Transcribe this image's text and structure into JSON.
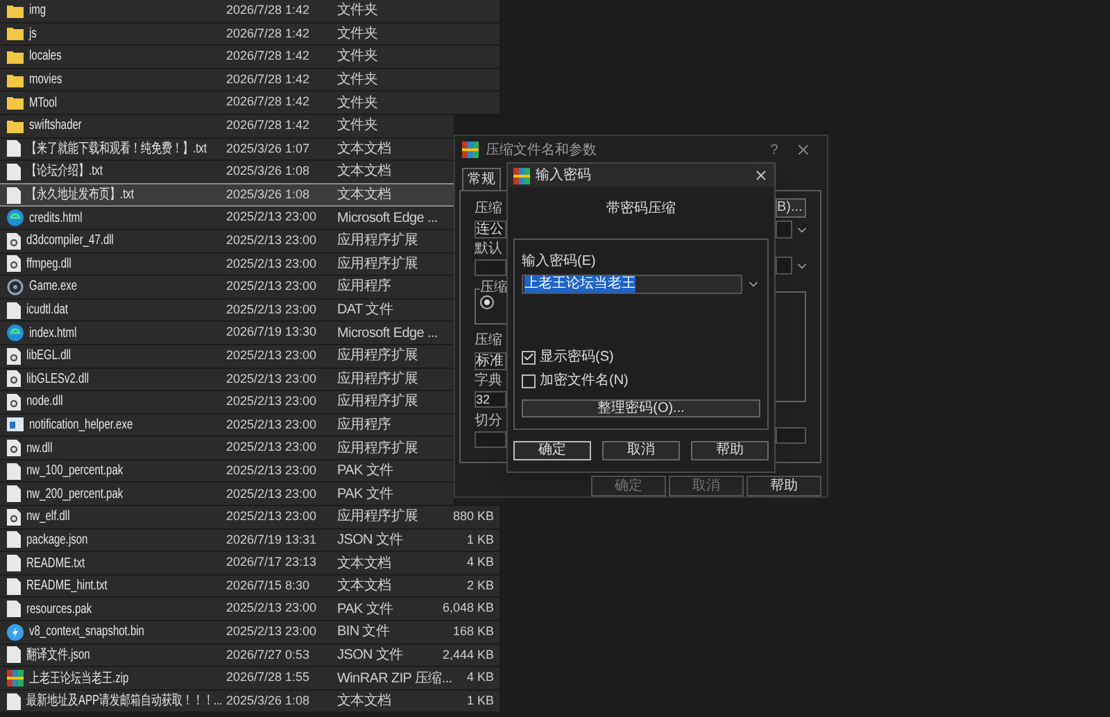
{
  "file_list": {
    "rows": [
      {
        "name": "img",
        "date": "2026/7/28 1:42",
        "type": "文件夹",
        "kind": "folder",
        "selected": false
      },
      {
        "name": "js",
        "date": "2026/7/28 1:42",
        "type": "文件夹",
        "kind": "folder",
        "selected": false
      },
      {
        "name": "locales",
        "date": "2026/7/28 1:42",
        "type": "文件夹",
        "kind": "folder",
        "selected": false
      },
      {
        "name": "movies",
        "date": "2026/7/28 1:42",
        "type": "文件夹",
        "kind": "folder",
        "selected": false
      },
      {
        "name": "MTool",
        "date": "2026/7/28 1:42",
        "type": "文件夹",
        "kind": "folder",
        "selected": false
      },
      {
        "name": "swiftshader",
        "date": "2026/7/28 1:42",
        "type": "文件夹",
        "kind": "folder",
        "selected": false
      },
      {
        "name": "【来了就能下载和观看！纯免费！】.txt",
        "date": "2025/3/26 1:07",
        "type": "文本文档",
        "kind": "text",
        "selected": false
      },
      {
        "name": "【论坛介绍】.txt",
        "date": "2025/3/26 1:08",
        "type": "文本文档",
        "kind": "text",
        "selected": false
      },
      {
        "name": "【永久地址发布页】.txt",
        "date": "2025/3/26 1:08",
        "type": "文本文档",
        "kind": "text",
        "selected": true
      },
      {
        "name": "credits.html",
        "date": "2025/2/13 23:00",
        "type": "Microsoft Edge ...",
        "kind": "web",
        "selected": false
      },
      {
        "name": "d3dcompiler_47.dll",
        "date": "2025/2/13 23:00",
        "type": "应用程序扩展",
        "kind": "dll",
        "selected": false
      },
      {
        "name": "ffmpeg.dll",
        "date": "2025/2/13 23:00",
        "type": "应用程序扩展",
        "kind": "dll",
        "selected": false
      },
      {
        "name": "Game.exe",
        "date": "2025/2/13 23:00",
        "type": "应用程序",
        "kind": "exe",
        "selected": false
      },
      {
        "name": "icudtl.dat",
        "date": "2025/2/13 23:00",
        "type": "DAT 文件",
        "kind": "text",
        "selected": false
      },
      {
        "name": "index.html",
        "date": "2026/7/19 13:30",
        "type": "Microsoft Edge ...",
        "kind": "web",
        "selected": false
      },
      {
        "name": "libEGL.dll",
        "date": "2025/2/13 23:00",
        "type": "应用程序扩展",
        "kind": "dll",
        "selected": false
      },
      {
        "name": "libGLESv2.dll",
        "date": "2025/2/13 23:00",
        "type": "应用程序扩展",
        "kind": "dll",
        "selected": false
      },
      {
        "name": "node.dll",
        "date": "2025/2/13 23:00",
        "type": "应用程序扩展",
        "kind": "dll",
        "selected": false
      },
      {
        "name": "notification_helper.exe",
        "date": "2025/2/13 23:00",
        "type": "应用程序",
        "kind": "app",
        "selected": false
      },
      {
        "name": "nw.dll",
        "date": "2025/2/13 23:00",
        "type": "应用程序扩展",
        "kind": "dll",
        "selected": false
      },
      {
        "name": "nw_100_percent.pak",
        "date": "2025/2/13 23:00",
        "type": "PAK 文件",
        "kind": "text",
        "selected": false
      },
      {
        "name": "nw_200_percent.pak",
        "date": "2025/2/13 23:00",
        "type": "PAK 文件",
        "kind": "text",
        "selected": false
      },
      {
        "name": "nw_elf.dll",
        "date": "2025/2/13 23:00",
        "type": "应用程序扩展",
        "size": "880 KB",
        "kind": "dll",
        "selected": false
      },
      {
        "name": "package.json",
        "date": "2026/7/19 13:31",
        "type": "JSON 文件",
        "size": "1 KB",
        "kind": "text",
        "selected": false
      },
      {
        "name": "README.txt",
        "date": "2026/7/17 23:13",
        "type": "文本文档",
        "size": "4 KB",
        "kind": "text",
        "selected": false
      },
      {
        "name": "README_hint.txt",
        "date": "2026/7/15 8:30",
        "type": "文本文档",
        "size": "2 KB",
        "kind": "text",
        "selected": false
      },
      {
        "name": "resources.pak",
        "date": "2025/2/13 23:00",
        "type": "PAK 文件",
        "size": "6,048 KB",
        "kind": "text",
        "selected": false
      },
      {
        "name": "v8_context_snapshot.bin",
        "date": "2025/2/13 23:00",
        "type": "BIN 文件",
        "size": "168 KB",
        "kind": "bin",
        "selected": false
      },
      {
        "name": "翻译文件.json",
        "date": "2026/7/27 0:53",
        "type": "JSON 文件",
        "size": "2,444 KB",
        "kind": "text",
        "selected": false
      },
      {
        "name": "上老王论坛当老王.zip",
        "date": "2026/7/28 1:55",
        "type": "WinRAR ZIP 压缩...",
        "size": "4 KB",
        "kind": "archive",
        "selected": false
      },
      {
        "name": "最新地址及APP请发邮箱自动获取！！！...",
        "date": "2025/3/26 1:08",
        "type": "文本文档",
        "size": "1 KB",
        "kind": "text",
        "selected": false
      }
    ]
  },
  "archive_dialog": {
    "title": "压缩文件名和参数",
    "help_glyph": "?",
    "tabs": [
      {
        "label": "常规",
        "selected": true
      }
    ],
    "archive_name_label": "压缩",
    "archive_name_value": "连公",
    "browse_button": "B)...",
    "profile_label": "默认",
    "format_group_label": "压缩",
    "format_radio_checked": true,
    "method_label": "压缩",
    "method_value": "标准",
    "dictionary_label": "字典",
    "dictionary_value": "32",
    "split_label": "切分",
    "buttons": [
      {
        "label": "确定",
        "disabled": true
      },
      {
        "label": "取消",
        "disabled": true
      },
      {
        "label": "帮助",
        "disabled": false
      }
    ]
  },
  "password_dialog": {
    "title": "输入密码",
    "heading": "带密码压缩",
    "password_label": "输入密码(E)",
    "password_value": "上老王论坛当老王",
    "password_value_highlighted": true,
    "checkboxes": [
      {
        "label": "显示密码(S)",
        "checked": true
      },
      {
        "label": "加密文件名(N)",
        "checked": false
      }
    ],
    "manage_button": "整理密码(O)...",
    "buttons": [
      {
        "label": "确定",
        "default": true
      },
      {
        "label": "取消",
        "default": false
      },
      {
        "label": "帮助",
        "default": false
      }
    ]
  }
}
